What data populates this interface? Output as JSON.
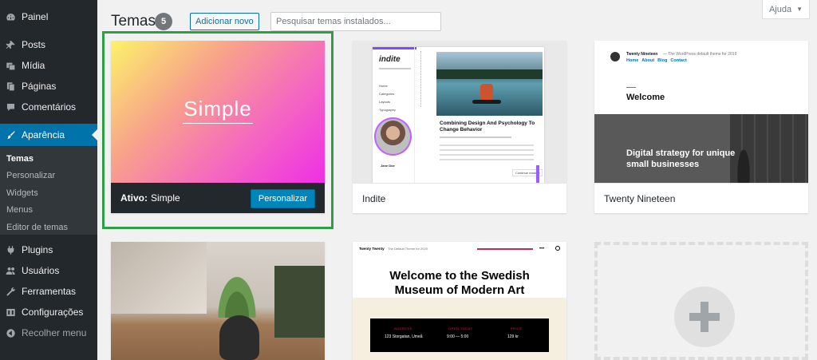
{
  "sidebar": {
    "items": [
      {
        "label": "Painel",
        "icon": "dashboard-icon"
      },
      {
        "label": "Posts",
        "icon": "pin-icon"
      },
      {
        "label": "Mídia",
        "icon": "media-icon"
      },
      {
        "label": "Páginas",
        "icon": "pages-icon"
      },
      {
        "label": "Comentários",
        "icon": "comments-icon"
      },
      {
        "label": "Aparência",
        "icon": "brush-icon"
      },
      {
        "label": "Plugins",
        "icon": "plugin-icon"
      },
      {
        "label": "Usuários",
        "icon": "users-icon"
      },
      {
        "label": "Ferramentas",
        "icon": "wrench-icon"
      },
      {
        "label": "Configurações",
        "icon": "settings-icon"
      },
      {
        "label": "Recolher menu",
        "icon": "collapse-icon"
      }
    ],
    "submenu": [
      "Temas",
      "Personalizar",
      "Widgets",
      "Menus",
      "Editor de temas"
    ]
  },
  "header": {
    "title": "Temas",
    "count": "5",
    "add_new": "Adicionar novo",
    "search_placeholder": "Pesquisar temas instalados...",
    "help": "Ajuda"
  },
  "themes": {
    "simple": {
      "preview_title": "Simple",
      "active_prefix": "Ativo:",
      "name": "Simple",
      "customize": "Personalizar"
    },
    "indite": {
      "name": "Indite",
      "logo": "indite",
      "menu": [
        "Home",
        "Categories",
        "Layouts",
        "Typography"
      ],
      "post_title": "Combining Design And Psychology To Change Behavior",
      "author": "Jane Doe",
      "cta": "Continue reading"
    },
    "twentynineteen": {
      "name": "Twenty Nineteen",
      "site_title": "Twenty Nineteen",
      "tagline": "— The WordPress default theme for 2019",
      "nav": [
        "Home",
        "About",
        "Blog",
        "Contact"
      ],
      "welcome": "Welcome",
      "hero": "Digital strategy for unique small businesses"
    },
    "twentytwenty": {
      "site_title": "Twenty Twenty",
      "tagline": "The Default Theme for 2020",
      "heading": "Welcome to the Swedish Museum of Modern Art",
      "info": [
        {
          "label": "ADDRESS",
          "value": "123 Storgatan, Umeå"
        },
        {
          "label": "OPEN TODAY",
          "value": "9:00 — 5:00"
        },
        {
          "label": "PRICE",
          "value": "129 kr"
        }
      ]
    }
  },
  "colors": {
    "admin_bar": "#23282d",
    "accent": "#0073aa",
    "active_outline": "#2ea043"
  }
}
